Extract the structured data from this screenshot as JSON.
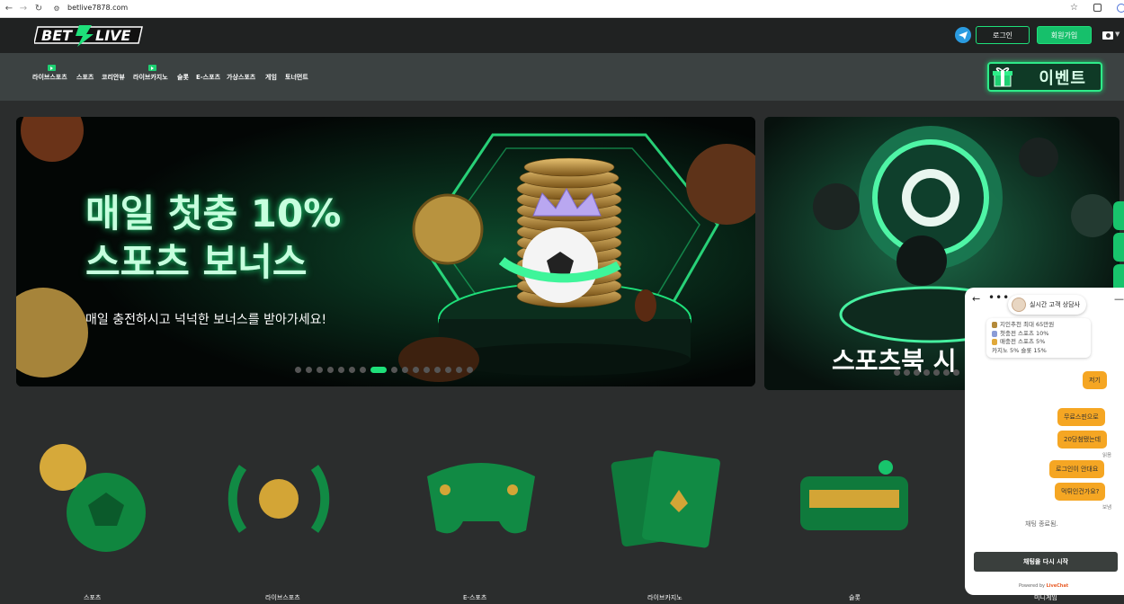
{
  "browser": {
    "url": "betlive7878.com"
  },
  "brand": {
    "logo_text": "BETLIVE",
    "accent": "#1ee07a",
    "dark_bg": "#2b2d2d"
  },
  "header": {
    "login_label": "로그인",
    "signup_label": "회원가입"
  },
  "nav": {
    "items": [
      "라이브스포츠",
      "스포츠",
      "코리안뷰",
      "라이브카지노",
      "슬롯",
      "E-스포츠",
      "가상스포츠",
      "게임",
      "토너먼트"
    ],
    "event_label": "이벤트"
  },
  "banner": {
    "line1": "매일 첫충 10%",
    "line2": "스포츠 보너스",
    "subtitle": "매일 충전하시고 넉넉한 보너스를 받아가세요!",
    "slide_count": 16,
    "active_slide": 8
  },
  "banner2": {
    "title": "스포츠북 시"
  },
  "categories": [
    "스포츠",
    "라이브스포츠",
    "E-스포츠",
    "라이브카지노",
    "슬롯",
    "미니게임"
  ],
  "chat": {
    "agent_name": "실시간 고객 상담사",
    "info_lines": [
      "지인추천 최대 65만원",
      "첫충전 스포츠 10%",
      "매충전 스포츠 5%",
      "카지노 5% 슬롯 15%"
    ],
    "messages": [
      "저기",
      "무료스핀으로",
      "20당첨됐는데",
      "로그인이 안대요",
      "먹튀인건가요?"
    ],
    "status_read": "읽음",
    "status_sent": "보냄",
    "ended_text": "채팅 종료됨.",
    "restart_label": "채팅을 다시 시작",
    "powered_prefix": "Powered by",
    "powered_brand": "LiveChat"
  }
}
